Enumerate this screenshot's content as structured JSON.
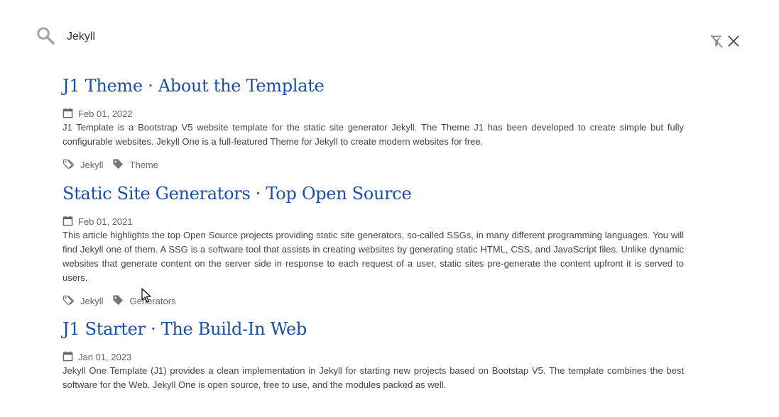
{
  "search": {
    "query": "Jekyll",
    "icon": "search-icon",
    "clear_filter_icon": "clear-filter-icon",
    "close_icon": "close-icon"
  },
  "colors": {
    "title_link": "#1a4fa8",
    "meta_text": "#666666",
    "body_text": "#444444",
    "icon_gray": "#9e9e9e"
  },
  "results": [
    {
      "title": "J1 Theme · About the Template",
      "date": "Feb 01, 2022",
      "description": "J1 Template is a Bootstrap V5 website template for the static site generator Jekyll. The Theme J1 has been developed to create simple but fully configurable websites. Jekyll One is a full-featured Theme for Jekyll to create modern websites for free.",
      "tag_outline": "Jekyll",
      "tag_filled": "Theme"
    },
    {
      "title": "Static Site Generators · Top Open Source",
      "date": "Feb 01, 2021",
      "description": "This article highlights the top Open Source projects providing static site generators, so-called SSGs, in many different programming languages. You will find Jekyll one of them. A SSG is a software tool that assists in creating websites by generating static HTML, CSS, and JavaScript files. Unlike dynamic websites that generate content on the server side in response to each request of a user, static sites pre-generate the content upfront it is served to users.",
      "tag_outline": "Jekyll",
      "tag_filled": "Generators"
    },
    {
      "title": "J1 Starter · The Build-In Web",
      "date": "Jan 01, 2023",
      "description": "Jekyll One Template (J1) provides a clean implementation in Jekyll for starting new projects based on Bootstap V5. The template combines the best software for the Web. Jekyll One is open source, free to use, and the modules packed as well."
    }
  ]
}
